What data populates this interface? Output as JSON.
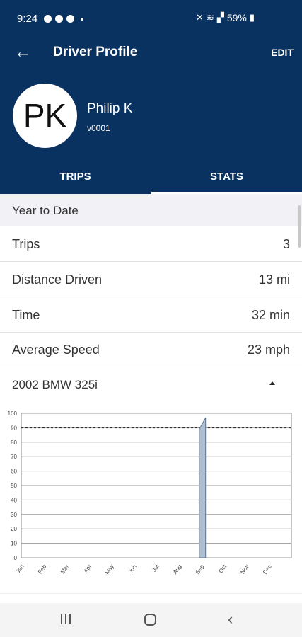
{
  "status_bar": {
    "time": "9:24",
    "battery": "59%"
  },
  "app_bar": {
    "title": "Driver Profile",
    "edit_label": "EDIT",
    "back_icon": "arrow-back-icon"
  },
  "profile": {
    "initials": "PK",
    "name": "Philip K",
    "id": "v0001"
  },
  "tabs": [
    {
      "label": "TRIPS",
      "selected": false
    },
    {
      "label": "STATS",
      "selected": true
    }
  ],
  "stats": {
    "section_title": "Year to Date",
    "rows": [
      {
        "label": "Trips",
        "value": "3"
      },
      {
        "label": "Distance Driven",
        "value": "13 mi"
      },
      {
        "label": "Time",
        "value": "32 min"
      },
      {
        "label": "Average Speed",
        "value": "23 mph"
      }
    ]
  },
  "vehicle": {
    "name": "2002 BMW 325i",
    "expanded": true
  },
  "colors": {
    "header_bg": "#0a3260",
    "bar_fill": "#aebfd2",
    "bar_stroke": "#5b7390"
  },
  "chart_data": {
    "type": "bar",
    "categories": [
      "Jan",
      "Feb",
      "Mar",
      "Apr",
      "May",
      "Jun",
      "Jul",
      "Aug",
      "Sep",
      "Oct",
      "Nov",
      "Dec"
    ],
    "values": [
      0,
      0,
      0,
      0,
      0,
      0,
      0,
      97,
      0,
      0,
      0,
      0
    ],
    "ylim": [
      0,
      100
    ],
    "yticks": [
      "0",
      "10",
      "20",
      "30",
      "40",
      "50",
      "60",
      "70",
      "80",
      "90",
      "100"
    ],
    "reference_line": 90,
    "grid": true
  }
}
